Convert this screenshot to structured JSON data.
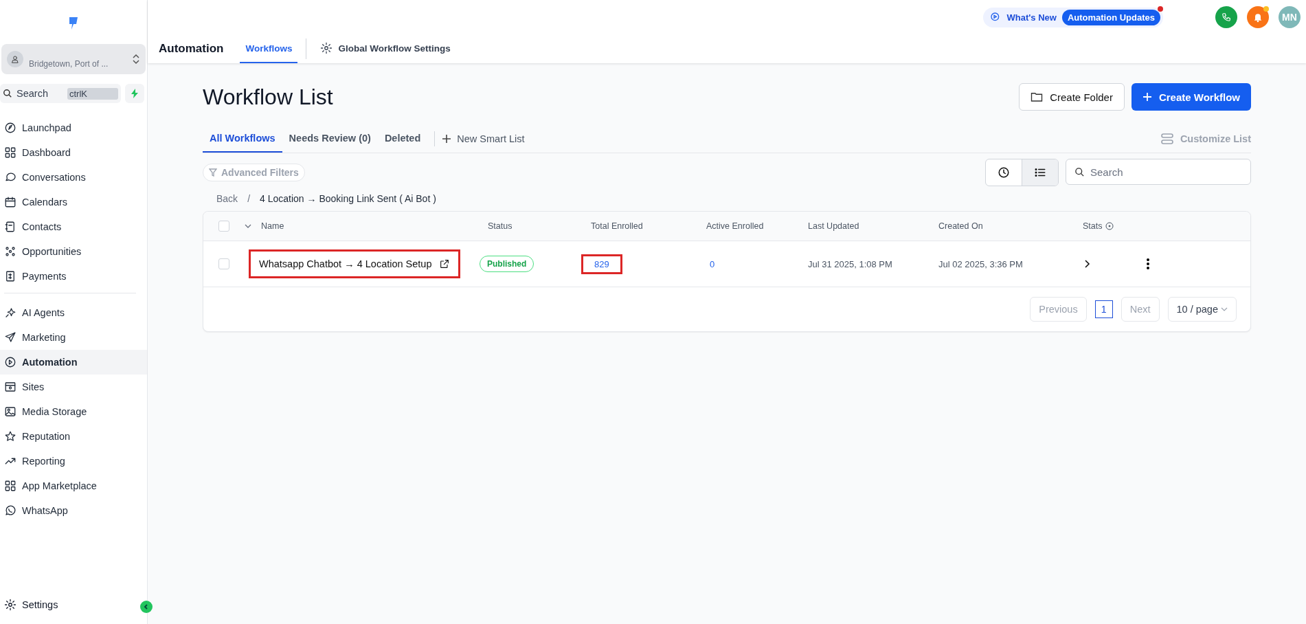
{
  "sidebar": {
    "account": {
      "subtitle": "Bridgetown, Port of ..."
    },
    "search": {
      "placeholder": "Search",
      "shortcut": "ctrlK"
    },
    "groups": [
      [
        {
          "label": "Launchpad",
          "selected": false
        },
        {
          "label": "Dashboard",
          "selected": false
        },
        {
          "label": "Conversations",
          "selected": false
        },
        {
          "label": "Calendars",
          "selected": false
        },
        {
          "label": "Contacts",
          "selected": false
        },
        {
          "label": "Opportunities",
          "selected": false
        },
        {
          "label": "Payments",
          "selected": false
        }
      ],
      [
        {
          "label": "AI Agents",
          "selected": false
        },
        {
          "label": "Marketing",
          "selected": false
        },
        {
          "label": "Automation",
          "selected": true
        },
        {
          "label": "Sites",
          "selected": false
        },
        {
          "label": "Media Storage",
          "selected": false
        },
        {
          "label": "Reputation",
          "selected": false
        },
        {
          "label": "Reporting",
          "selected": false
        },
        {
          "label": "App Marketplace",
          "selected": false
        },
        {
          "label": "WhatsApp",
          "selected": false
        }
      ]
    ],
    "settings": "Settings"
  },
  "header": {
    "title": "Automation",
    "tabs": [
      {
        "label": "Workflows",
        "selected": true
      },
      {
        "label": "Global Workflow Settings",
        "selected": false
      }
    ],
    "whats_new": "What's New",
    "updates": "Automation Updates",
    "avatar": "MN"
  },
  "page": {
    "title": "Workflow List",
    "create_folder": "Create Folder",
    "create_workflow": "Create Workflow",
    "tabs": [
      {
        "label": "All Workflows",
        "selected": true
      },
      {
        "label": "Needs Review (0)",
        "selected": false
      },
      {
        "label": "Deleted",
        "selected": false
      }
    ],
    "new_smart_list": "New Smart List",
    "customize": "Customize List",
    "advanced_filters": "Advanced Filters",
    "views": [
      {
        "kind": "clock",
        "selected": false
      },
      {
        "kind": "list",
        "selected": true
      }
    ],
    "search": {
      "placeholder": "Search"
    },
    "breadcrumb": {
      "back": "Back",
      "separator": "/",
      "current": "4 Location → Booking Link Sent ( Ai Bot )"
    }
  },
  "table": {
    "select_all_checked": false,
    "columns": [
      "Name",
      "Status",
      "Total Enrolled",
      "Active Enrolled",
      "Last Updated",
      "Created On",
      "Stats"
    ],
    "rows": [
      {
        "checked": false,
        "name": "Whatsapp Chatbot → 4 Location Setup",
        "name_highlighted": true,
        "status": "Published",
        "total_enrolled": "829",
        "total_highlighted": true,
        "active_enrolled": "0",
        "last_updated": "Jul 31 2025, 1:08 PM",
        "created_on": "Jul 02 2025, 3:36 PM"
      }
    ]
  },
  "pagination": {
    "previous": "Previous",
    "pages": [
      {
        "label": "1",
        "selected": true
      }
    ],
    "next": "Next",
    "page_size": "10 / page"
  }
}
